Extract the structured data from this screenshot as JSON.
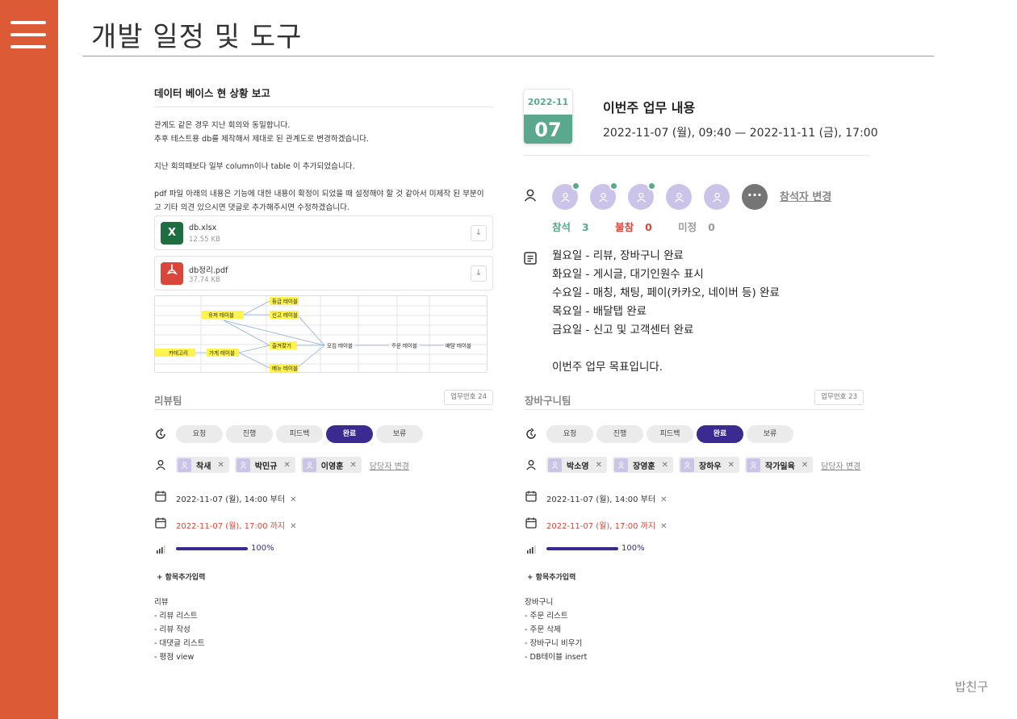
{
  "page": {
    "title": "개발 일정 및 도구",
    "footer": "밥친구"
  },
  "doc": {
    "heading": "데이터 베이스 현 상황 보고",
    "lines": [
      "관계도 같은 경우 지난 회의와 동일합니다.",
      "추후 테스트용 db를 제작해서 제대로 된 관계도로 변경하겠습니다.",
      "",
      "지난 회의때보다 일부 column이나 table 이 추가되었습니다.",
      "",
      "pdf 파일 아래의 내용은 기능에 대한 내용이 확정이 되었을 때 설정해야 할 것 같아서 미제작 된 부분이",
      "고 기타 의견 있으시면 댓글로 추가해주시면 수정하겠습니다."
    ],
    "files": [
      {
        "name": "db.xlsx",
        "size": "12.55 KB",
        "icon": "excel-icon",
        "color": "#1e6e42"
      },
      {
        "name": "db정리.pdf",
        "size": "37.74 KB",
        "icon": "pdf-icon",
        "color": "#d9463a"
      }
    ],
    "diagram": {
      "labels": [
        "등급 테이블",
        "유저 테이블",
        "신고 테이블",
        "카테고리",
        "가게 테이블",
        "즐겨찾기",
        "모집 테이블",
        "주문 테이블",
        "배달 테이블",
        "메뉴 테이블"
      ]
    }
  },
  "event": {
    "month": "2022-11",
    "day": "07",
    "title": "이번주 업무 내용",
    "time": "2022-11-07 (월), 09:40 — 2022-11-11 (금), 17:00",
    "attendees": [
      {
        "confirmed": true
      },
      {
        "confirmed": true
      },
      {
        "confirmed": true
      },
      {
        "confirmed": false
      },
      {
        "confirmed": false
      }
    ],
    "more_label": "···",
    "change_label": "참석자 변경",
    "stats": [
      {
        "label": "참석",
        "count": "3",
        "color": "#5aa88e"
      },
      {
        "label": "불참",
        "count": "0",
        "color": "#d9463a"
      },
      {
        "label": "미정",
        "count": "0",
        "color": "#999999"
      }
    ],
    "description": [
      "월요일 - 리뷰, 장바구니 완료",
      "화요일 - 게시글, 대기인원수 표시",
      "수요일 - 매칭, 채팅, 페이(카카오, 네이버 등) 완료",
      "목요일 - 배달탭 완료",
      "금요일 - 신고 및 고객센터 완료",
      "",
      "이번주 업무 목표입니다."
    ]
  },
  "tasks": [
    {
      "team": "리뷰팀",
      "task_no": "업무번호 24",
      "statuses": [
        "요청",
        "진행",
        "피드백",
        "완료",
        "보류"
      ],
      "active_status": "완료",
      "assignees": [
        "착새",
        "박민규",
        "이영훈"
      ],
      "assignee_change": "담당자 변경",
      "start": "2022-11-07 (월), 14:00 부터",
      "end": "2022-11-07 (월), 17:00 까지",
      "progress": "100%",
      "progress_value": 1.0,
      "add_label": "+ 항목추가입력",
      "notes": [
        "리뷰",
        "- 리뷰 리스트",
        "- 리뷰 작성",
        "- 대댓글 리스트",
        "- 평점 view"
      ]
    },
    {
      "team": "장바구니팀",
      "task_no": "업무번호 23",
      "statuses": [
        "요청",
        "진행",
        "피드백",
        "완료",
        "보류"
      ],
      "active_status": "완료",
      "assignees": [
        "박소영",
        "장영훈",
        "장하우",
        "작가일육"
      ],
      "assignee_change": "담당자 변경",
      "start": "2022-11-07 (월), 14:00 부터",
      "end": "2022-11-07 (월), 17:00 까지",
      "progress": "100%",
      "progress_value": 1.0,
      "add_label": "+ 항목추가입력",
      "notes": [
        "장바구니",
        "- 주문 리스트",
        "- 주문 삭제",
        "- 장바구니 비우기",
        "- DB테이블 insert"
      ]
    }
  ],
  "colors": {
    "sidebar": "#dc5a36",
    "accent": "#3b2a8f",
    "green": "#5aa88e",
    "red": "#d9463a",
    "avatar": "#cbc4e8"
  }
}
